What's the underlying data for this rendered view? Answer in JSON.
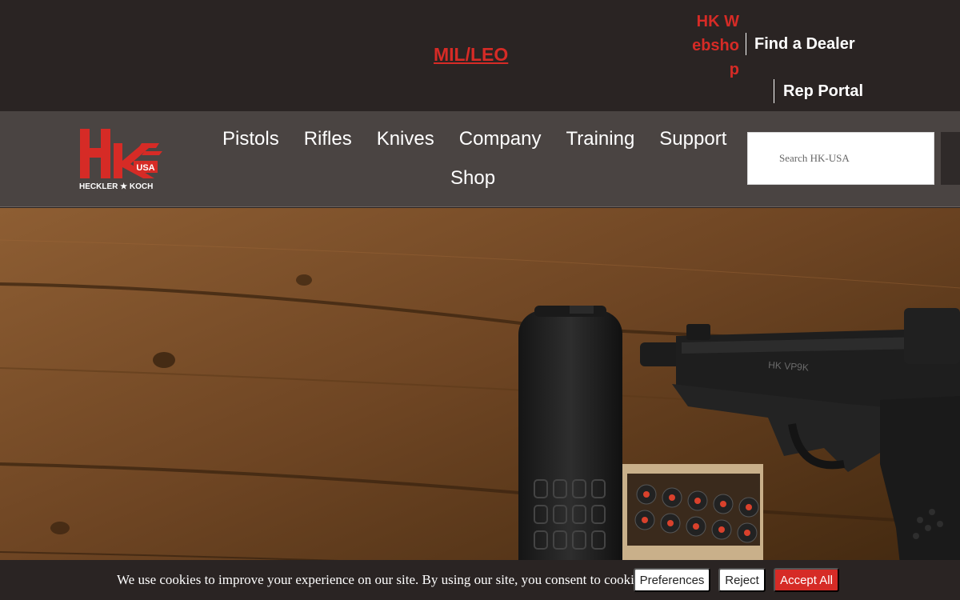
{
  "topbar": {
    "mil_leo": "MIL/LEO",
    "webshop": "HK Webshop",
    "find_dealer": "Find a Dealer",
    "rep_portal": "Rep Portal"
  },
  "logo": {
    "brand_text": "HECKLER ★ KOCH",
    "usa_text": "USA",
    "brand_color": "#d62b26"
  },
  "nav": {
    "items": [
      "Pistols",
      "Rifles",
      "Knives",
      "Company",
      "Training",
      "Support"
    ],
    "second_row": "Shop"
  },
  "search": {
    "placeholder": "Search HK-USA"
  },
  "hero": {
    "slide_text_on_pistol": "HK VP9K"
  },
  "cookie": {
    "message": "We use cookies to improve your experience on our site. By using our site, you consent to cookies.",
    "preferences_label": "Preferences",
    "reject_label": "Reject",
    "accept_label": "Accept All"
  },
  "colors": {
    "accent": "#d62b26",
    "topbar_bg": "#2a2423",
    "navbar_bg": "#4a4442"
  }
}
